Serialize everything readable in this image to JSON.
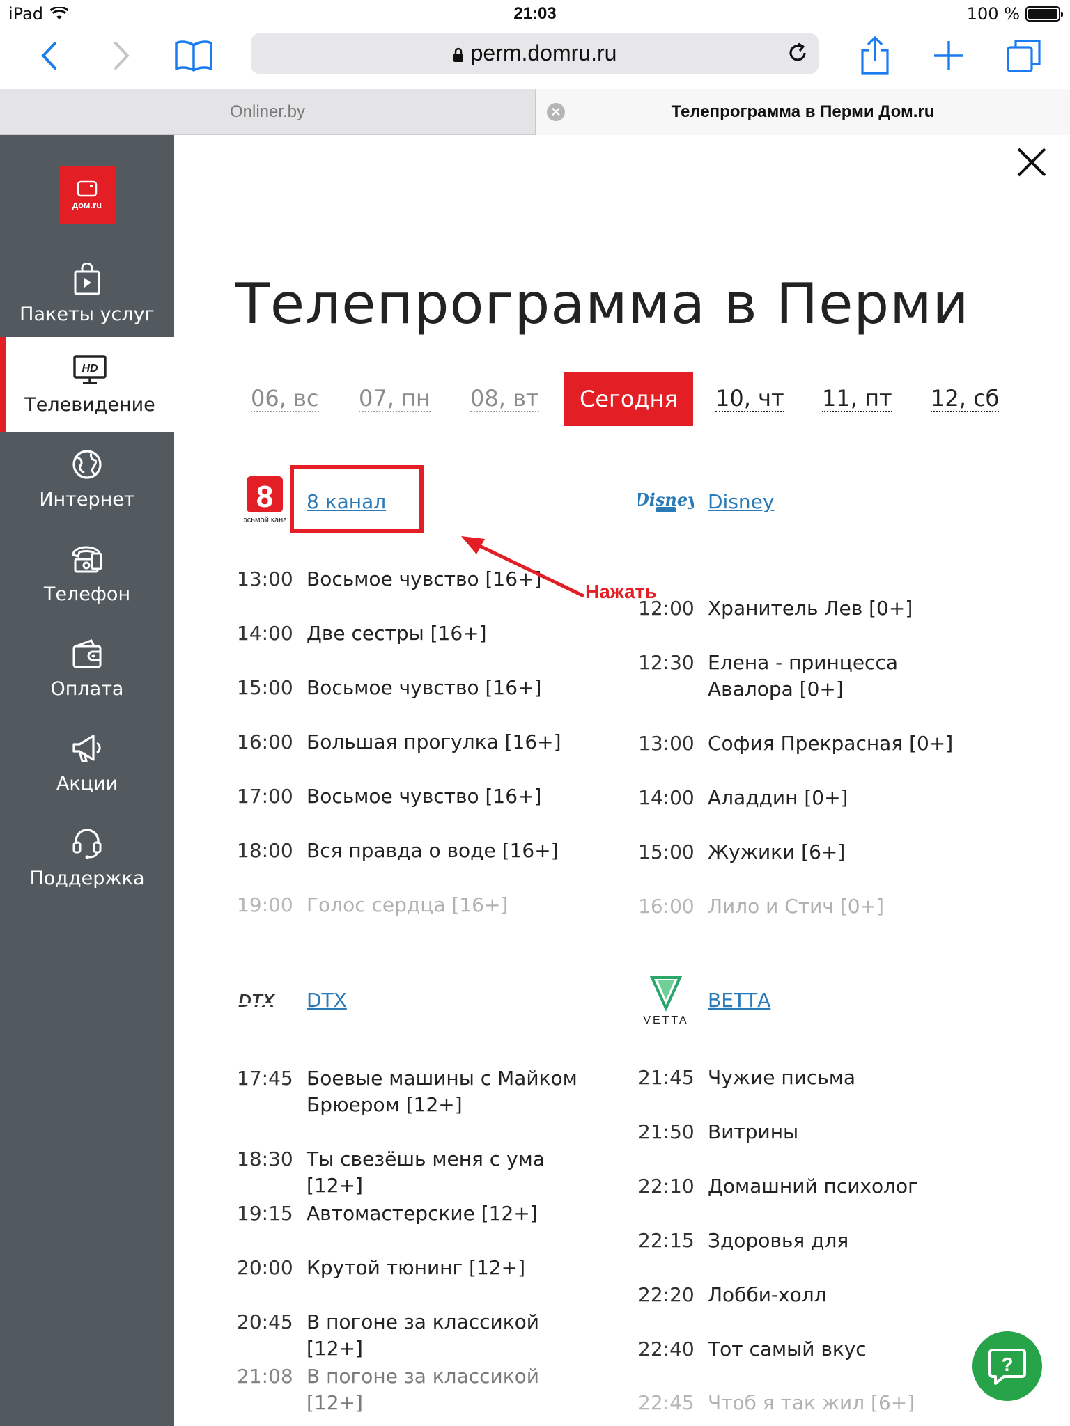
{
  "status_bar": {
    "device": "iPad",
    "time": "21:03",
    "battery": "100 %"
  },
  "browser": {
    "url": "perm.domru.ru",
    "tabs": [
      {
        "label": "Onliner.by"
      },
      {
        "label": "Телепрограмма в Перми Дом.ru"
      }
    ]
  },
  "sidebar": {
    "logo_text": "дом.ru",
    "items": [
      {
        "label": "Пакеты услуг",
        "icon": "bag-play-icon"
      },
      {
        "label": "Телевидение",
        "icon": "hd-tv-icon",
        "active": true
      },
      {
        "label": "Интернет",
        "icon": "globe-icon"
      },
      {
        "label": "Телефон",
        "icon": "phone-icon"
      },
      {
        "label": "Оплата",
        "icon": "wallet-icon"
      },
      {
        "label": "Акции",
        "icon": "megaphone-icon"
      },
      {
        "label": "Поддержка",
        "icon": "headset-icon"
      }
    ]
  },
  "page": {
    "title": "Телепрограмма в Перми",
    "days": [
      {
        "label": "06, вс"
      },
      {
        "label": "07, пн"
      },
      {
        "label": "08, вт"
      },
      {
        "label": "Сегодня"
      },
      {
        "label": "10, чт"
      },
      {
        "label": "11, пт"
      },
      {
        "label": "12, сб"
      }
    ],
    "annotation": "Нажать",
    "logo_8_text": "Восьмой канал",
    "logo_vetta_text": "VETTA"
  },
  "channels": [
    {
      "name": "8 канал",
      "logo": "8-kanal-logo",
      "programs": [
        {
          "time": "13:00",
          "title": "Восьмое чувство [16+]"
        },
        {
          "time": "14:00",
          "title": "Две сестры [16+]"
        },
        {
          "time": "15:00",
          "title": "Восьмое чувство [16+]"
        },
        {
          "time": "16:00",
          "title": "Большая прогулка [16+]"
        },
        {
          "time": "17:00",
          "title": "Восьмое чувство [16+]"
        },
        {
          "time": "18:00",
          "title": "Вся правда о воде [16+]"
        },
        {
          "time": "19:00",
          "title": "Голос сердца [16+]"
        }
      ]
    },
    {
      "name": "Disney",
      "logo": "disney-logo",
      "programs": [
        {
          "time": "12:00",
          "title": "Хранитель Лев [0+]"
        },
        {
          "time": "12:30",
          "title": "Елена - принцесса Авалора [0+]"
        },
        {
          "time": "13:00",
          "title": "София Прекрасная [0+]"
        },
        {
          "time": "14:00",
          "title": "Аладдин [0+]"
        },
        {
          "time": "15:00",
          "title": "Жужики [6+]"
        },
        {
          "time": "16:00",
          "title": "Лило и Стич [0+]"
        }
      ]
    },
    {
      "name": "DTX",
      "logo": "dtx-logo",
      "programs": [
        {
          "time": "17:45",
          "title": "Боевые машины с Майком Брюером [12+]"
        },
        {
          "time": "18:30",
          "title": "Ты свезёшь меня с ума [12+]"
        },
        {
          "time": "19:15",
          "title": "Автомастерские [12+]"
        },
        {
          "time": "20:00",
          "title": "Крутой тюнинг [12+]"
        },
        {
          "time": "20:45",
          "title": "В погоне за классикой [12+]"
        },
        {
          "time": "21:08",
          "title": "В погоне за классикой [12+]"
        }
      ]
    },
    {
      "name": "ВЕТТА",
      "logo": "vetta-logo",
      "programs": [
        {
          "time": "21:45",
          "title": "Чужие письма"
        },
        {
          "time": "21:50",
          "title": "Витрины"
        },
        {
          "time": "22:10",
          "title": "Домашний психолог"
        },
        {
          "time": "22:15",
          "title": "Здоровья для"
        },
        {
          "time": "22:20",
          "title": "Лобби-холл"
        },
        {
          "time": "22:40",
          "title": "Тот самый вкус"
        },
        {
          "time": "22:45",
          "title": "Чтоб я так жил [6+]"
        }
      ]
    }
  ],
  "colors": {
    "accent": "#e31e24",
    "sidebar": "#525a60",
    "link": "#2a7ab8",
    "help": "#27a34a"
  }
}
